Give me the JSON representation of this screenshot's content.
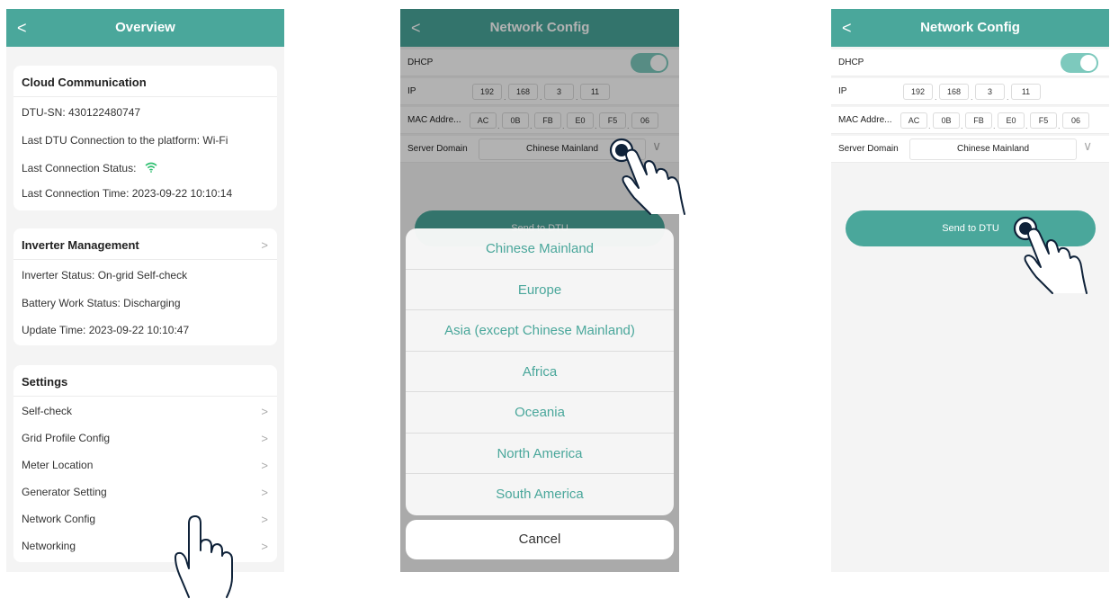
{
  "screen1": {
    "nav": {
      "back": "<",
      "title": "Overview"
    },
    "cloud": {
      "title": "Cloud Communication",
      "sn": "DTU-SN:  430122480747",
      "last_connection": "Last DTU Connection to the platform:  Wi-Fi",
      "status_label": "Last Connection Status:",
      "status_icon": "wifi-icon",
      "last_time": "Last Connection Time:  2023-09-22 10:10:14"
    },
    "inverter": {
      "title": "Inverter Management",
      "status": "Inverter Status:  On-grid Self-check",
      "battery": "Battery Work Status:  Discharging",
      "update": "Update Time:  2023-09-22 10:10:47"
    },
    "settings": {
      "title": "Settings",
      "items": [
        "Self-check",
        "Grid Profile Config",
        "Meter Location",
        "Generator Setting",
        "Network Config",
        "Networking"
      ]
    }
  },
  "screen2": {
    "nav": {
      "back": "<",
      "title": "Network Config"
    },
    "dhcp_label": "DHCP",
    "ip_label": "IP",
    "ip": [
      "192",
      "168",
      "3",
      "11"
    ],
    "mac_label": "MAC Addre...",
    "mac": [
      "AC",
      "0B",
      "FB",
      "E0",
      "F5",
      "06"
    ],
    "server_label": "Server Domain",
    "server_value": "Chinese Mainland",
    "send_label": "Send to DTU",
    "options": [
      "Chinese Mainland",
      "Europe",
      "Asia (except Chinese Mainland)",
      "Africa",
      "Oceania",
      "North America",
      "South America"
    ],
    "cancel_label": "Cancel"
  },
  "screen3": {
    "nav": {
      "back": "<",
      "title": "Network Config"
    },
    "dhcp_label": "DHCP",
    "ip_label": "IP",
    "ip": [
      "192",
      "168",
      "3",
      "11"
    ],
    "mac_label": "MAC Addre...",
    "mac": [
      "AC",
      "0B",
      "FB",
      "E0",
      "F5",
      "06"
    ],
    "server_label": "Server Domain",
    "server_value": "Chinese Mainland",
    "send_label": "Send to DTU"
  },
  "colors": {
    "accent": "#4aa79b",
    "toggle_on": "#7dc9bd"
  }
}
